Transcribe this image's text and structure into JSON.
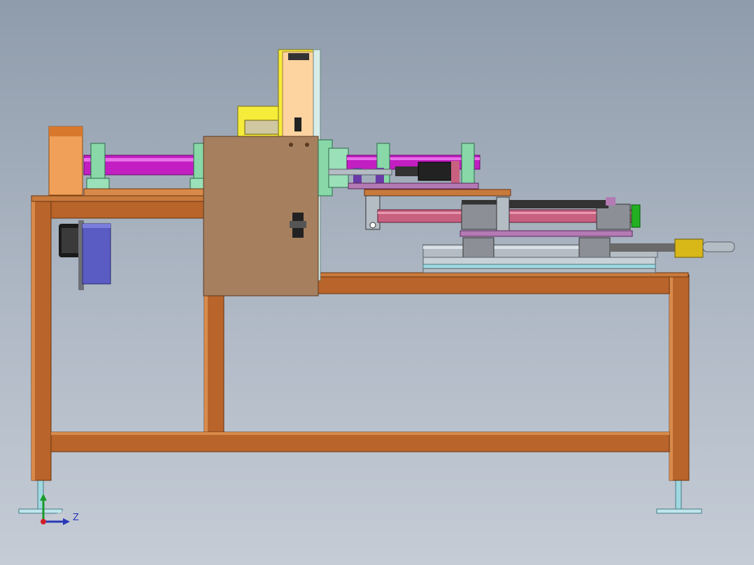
{
  "viewport": {
    "background_top": "#8f9cab",
    "background_bottom": "#c5ccd6"
  },
  "triad": {
    "axis_z_label": "Z",
    "x_color": "#d0202a",
    "y_color": "#1a9a2a",
    "z_color": "#2a3ab8"
  },
  "colors": {
    "frame": "#b8642a",
    "frame_dark": "#7a3e14",
    "frame_light": "#d88a4a",
    "panel": "#a57f5e",
    "shaft": "#c21ec2",
    "bearing": "#88d8a8",
    "yellow": "#f6ec3a",
    "peach": "#fdd3a0",
    "pink": "#c86080",
    "motor_blue": "#5a5cc4",
    "rail": "#b4bcc4",
    "block": "#8c9096",
    "purple": "#b47ab4",
    "green": "#22b022",
    "gold": "#d8b818",
    "foot": "#9fd8e0"
  }
}
